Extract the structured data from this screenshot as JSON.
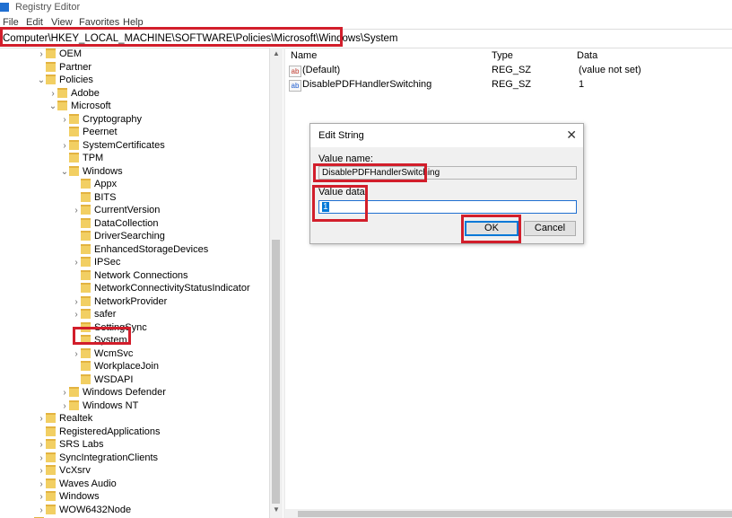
{
  "window": {
    "title": "Registry Editor"
  },
  "menu": [
    "File",
    "Edit",
    "View",
    "Favorites",
    "Help"
  ],
  "address": {
    "path": "Computer\\HKEY_LOCAL_MACHINE\\SOFTWARE\\Policies\\Microsoft\\Windows\\System"
  },
  "tree": [
    {
      "label": "OEM",
      "chev": "›"
    },
    {
      "label": "Partner",
      "chev": ""
    },
    {
      "label": "Policies",
      "chev": "⌄"
    },
    {
      "label": "Adobe",
      "chev": "›"
    },
    {
      "label": "Microsoft",
      "chev": "⌄"
    },
    {
      "label": "Cryptography",
      "chev": "›"
    },
    {
      "label": "Peernet",
      "chev": ""
    },
    {
      "label": "SystemCertificates",
      "chev": "›"
    },
    {
      "label": "TPM",
      "chev": ""
    },
    {
      "label": "Windows",
      "chev": "⌄"
    },
    {
      "label": "Appx",
      "chev": ""
    },
    {
      "label": "BITS",
      "chev": ""
    },
    {
      "label": "CurrentVersion",
      "chev": "›"
    },
    {
      "label": "DataCollection",
      "chev": ""
    },
    {
      "label": "DriverSearching",
      "chev": ""
    },
    {
      "label": "EnhancedStorageDevices",
      "chev": ""
    },
    {
      "label": "IPSec",
      "chev": "›"
    },
    {
      "label": "Network Connections",
      "chev": ""
    },
    {
      "label": "NetworkConnectivityStatusIndicator",
      "chev": ""
    },
    {
      "label": "NetworkProvider",
      "chev": "›"
    },
    {
      "label": "safer",
      "chev": "›"
    },
    {
      "label": "SettingSync",
      "chev": ""
    },
    {
      "label": "System",
      "chev": ""
    },
    {
      "label": "WcmSvc",
      "chev": "›"
    },
    {
      "label": "WorkplaceJoin",
      "chev": ""
    },
    {
      "label": "WSDAPI",
      "chev": ""
    },
    {
      "label": "Windows Defender",
      "chev": "›"
    },
    {
      "label": "Windows NT",
      "chev": "›"
    },
    {
      "label": "Realtek",
      "chev": "›"
    },
    {
      "label": "RegisteredApplications",
      "chev": ""
    },
    {
      "label": "SRS Labs",
      "chev": "›"
    },
    {
      "label": "SyncIntegrationClients",
      "chev": "›"
    },
    {
      "label": "VcXsrv",
      "chev": "›"
    },
    {
      "label": "Waves Audio",
      "chev": "›"
    },
    {
      "label": "Windows",
      "chev": "›"
    },
    {
      "label": "WOW6432Node",
      "chev": "›"
    },
    {
      "label": "SYSTEM",
      "chev": "›"
    }
  ],
  "list": {
    "headers": {
      "name": "Name",
      "type": "Type",
      "data": "Data"
    },
    "rows": [
      {
        "name": "(Default)",
        "type": "REG_SZ",
        "data": "(value not set)",
        "icon": "ab"
      },
      {
        "name": "DisablePDFHandlerSwitching",
        "type": "REG_SZ",
        "data": "1",
        "icon": "ab"
      }
    ]
  },
  "dialog": {
    "title": "Edit String",
    "value_name_label": "Value name:",
    "value_name": "DisablePDFHandlerSwitching",
    "value_data_label": "Value data:",
    "value_data": "1",
    "ok": "OK",
    "cancel": "Cancel"
  },
  "colors": {
    "highlight": "#d21e2b",
    "folder": "#f2cf63",
    "selection": "#0078d7"
  }
}
